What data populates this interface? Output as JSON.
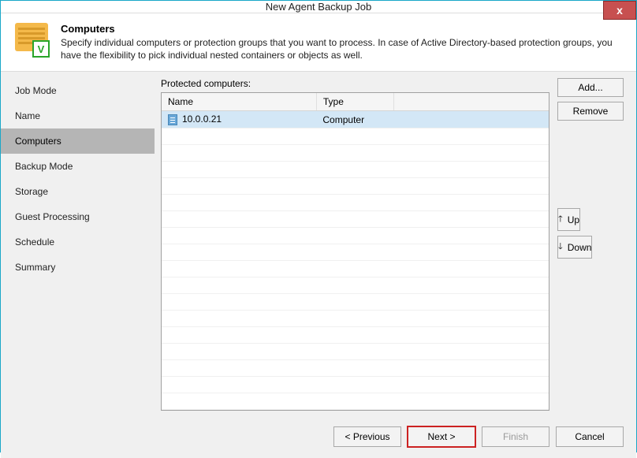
{
  "window": {
    "title": "New Agent Backup Job",
    "close_glyph": "x"
  },
  "header": {
    "title": "Computers",
    "description": "Specify individual computers or protection groups that you want to process. In case of Active Directory-based protection groups, you have the flexibility to pick individual nested containers or objects as well.",
    "badge_letter": "V"
  },
  "sidebar": {
    "items": [
      {
        "label": "Job Mode",
        "selected": false
      },
      {
        "label": "Name",
        "selected": false
      },
      {
        "label": "Computers",
        "selected": true
      },
      {
        "label": "Backup Mode",
        "selected": false
      },
      {
        "label": "Storage",
        "selected": false
      },
      {
        "label": "Guest Processing",
        "selected": false
      },
      {
        "label": "Schedule",
        "selected": false
      },
      {
        "label": "Summary",
        "selected": false
      }
    ]
  },
  "table": {
    "label": "Protected computers:",
    "columns": [
      "Name",
      "Type"
    ],
    "rows": [
      {
        "name": "10.0.0.21",
        "type": "Computer",
        "selected": true
      }
    ]
  },
  "buttons": {
    "add": "Add...",
    "remove": "Remove",
    "up": "Up",
    "down": "Down",
    "up_arrow": "🡑",
    "down_arrow": "🡓"
  },
  "footer": {
    "previous": "< Previous",
    "next": "Next >",
    "finish": "Finish",
    "cancel": "Cancel"
  }
}
